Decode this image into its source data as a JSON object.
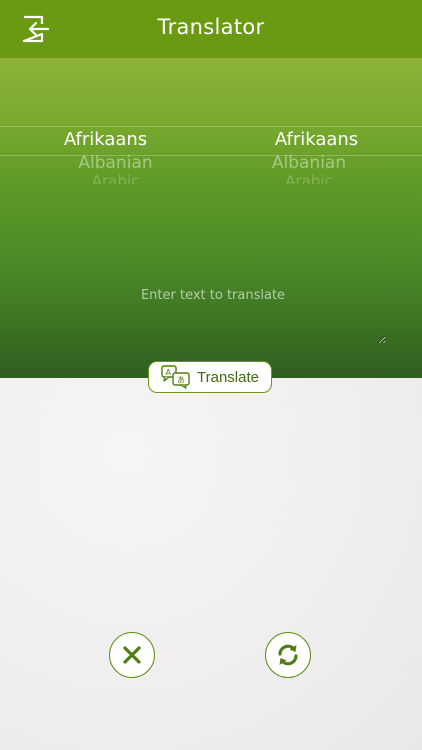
{
  "app": {
    "title": "Translator"
  },
  "header": {
    "back_icon": "exit-arrow-icon"
  },
  "pickers": {
    "source": {
      "selected": "Afrikaans",
      "next": "Albanian",
      "next2": "Arabic"
    },
    "target": {
      "selected": "Afrikaans",
      "next": "Albanian",
      "next2": "Arabic"
    }
  },
  "input": {
    "value": "",
    "placeholder": "Enter text to translate"
  },
  "translate_button": {
    "label": "Translate",
    "icon": "translate-speech-bubbles-icon"
  },
  "actions": {
    "clear_icon": "close-x-icon",
    "swap_icon": "refresh-swap-icon"
  },
  "colors": {
    "header_green": "#6a9a12",
    "accent_green": "#5a8f16",
    "panel_top": "#8db338",
    "panel_bottom": "#2f5e20",
    "background": "#efeded"
  }
}
